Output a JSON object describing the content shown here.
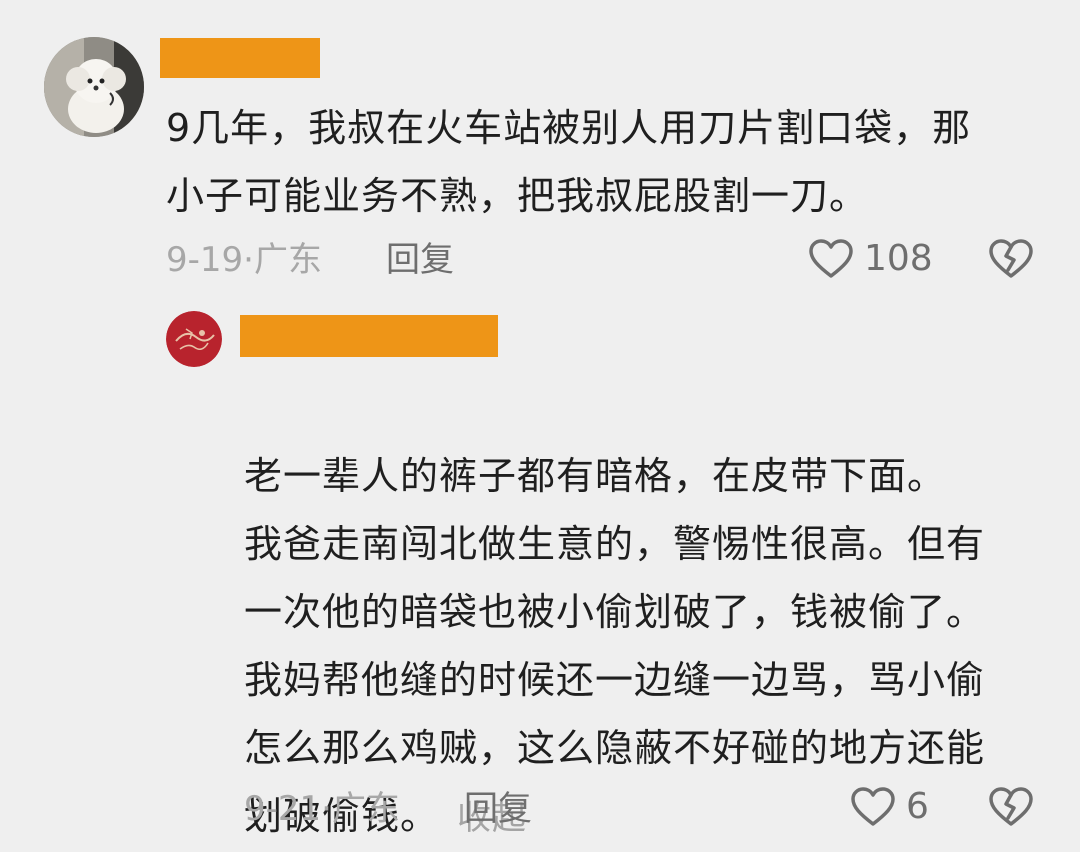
{
  "comments": [
    {
      "text": "9几年，我叔在火车站被别人用刀片割口袋，那\n小子可能业务不熟，把我叔屁股割一刀。",
      "date": "9-19",
      "location": "广东",
      "reply_label": "回复",
      "like_count": "108",
      "icons": {
        "like": "heart-outline-icon",
        "dislike": "broken-heart-icon"
      }
    }
  ],
  "replies": [
    {
      "text": "老一辈人的裤子都有暗格，在皮带下面。\n我爸走南闯北做生意的，警惕性很高。但有\n一次他的暗袋也被小偷划破了，钱被偷了。\n我妈帮他缝的时候还一边缝一边骂，骂小偷\n怎么那么鸡贼，这么隐蔽不好碰的地方还能\n划破偷钱。",
      "collapse_label": "收起",
      "date": "9-21",
      "location": "广东",
      "reply_label": "回复",
      "like_count": "6",
      "icons": {
        "like": "heart-outline-icon",
        "dislike": "broken-heart-icon"
      }
    }
  ],
  "colors": {
    "background": "#efefef",
    "redaction": "#ee9517",
    "text": "#1f1f1f",
    "meta": "#a7a7a7",
    "reply": "#6e6e6e"
  }
}
